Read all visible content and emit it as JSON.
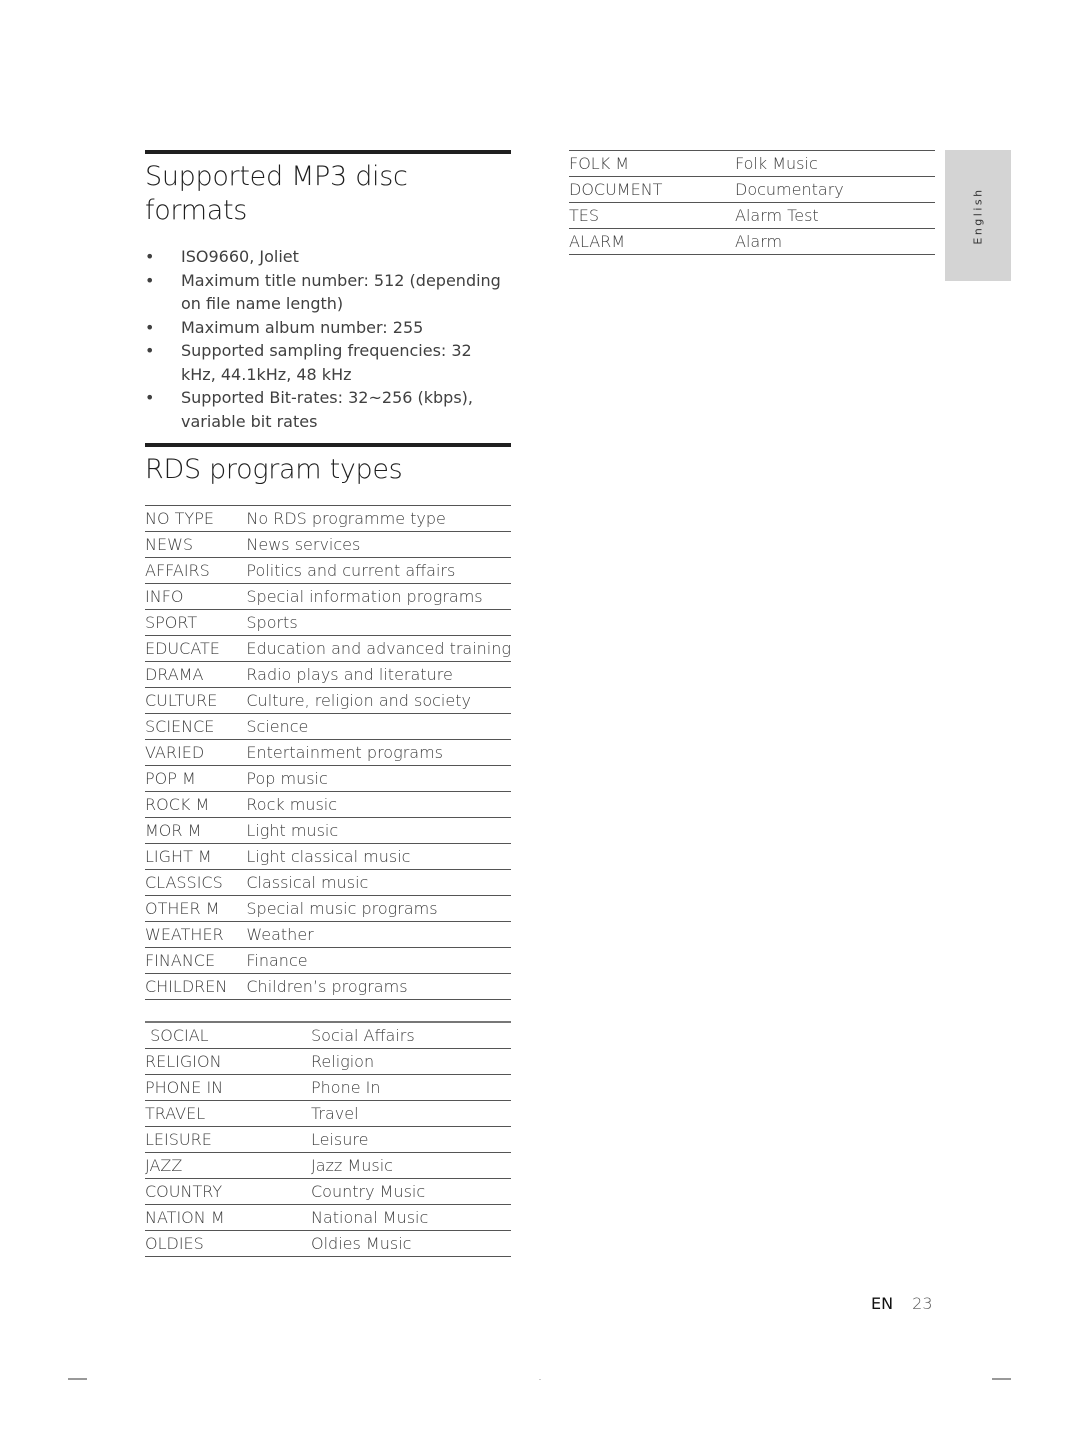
{
  "mp3_section": {
    "title": "Supported MP3 disc formats",
    "bullet_glyph": "•",
    "items": [
      "ISO9660, Joliet",
      "Maximum title number: 512 (depending on file name length)",
      "Maximum album number: 255",
      "Supported sampling frequencies: 32 kHz, 44.1kHz, 48 kHz",
      "Supported Bit-rates: 32~256 (kbps), variable bit rates"
    ]
  },
  "rds_section": {
    "title": "RDS program types",
    "table1": [
      {
        "code": "NO TYPE",
        "desc": "No RDS programme type"
      },
      {
        "code": "NEWS",
        "desc": "News services"
      },
      {
        "code": "AFFAIRS",
        "desc": "Politics and current affairs"
      },
      {
        "code": "INFO",
        "desc": "Special information programs"
      },
      {
        "code": "SPORT",
        "desc": "Sports"
      },
      {
        "code": "EDUCATE",
        "desc": "Education and advanced training"
      },
      {
        "code": "DRAMA",
        "desc": "Radio plays and literature"
      },
      {
        "code": "CULTURE",
        "desc": "Culture, religion and society"
      },
      {
        "code": "SCIENCE",
        "desc": "Science"
      },
      {
        "code": "VARIED",
        "desc": "Entertainment programs"
      },
      {
        "code": "POP M",
        "desc": "Pop music"
      },
      {
        "code": "ROCK M",
        "desc": "Rock music"
      },
      {
        "code": "MOR M",
        "desc": "Light music"
      },
      {
        "code": "LIGHT M",
        "desc": "Light classical music"
      },
      {
        "code": "CLASSICS",
        "desc": "Classical music"
      },
      {
        "code": "OTHER M",
        "desc": "Special music programs"
      },
      {
        "code": "WEATHER",
        "desc": "Weather"
      },
      {
        "code": "FINANCE",
        "desc": "Finance"
      },
      {
        "code": "CHILDREN",
        "desc": "Children’s programs"
      }
    ],
    "table2": [
      {
        "code": " SOCIAL",
        "desc": "Social Affairs"
      },
      {
        "code": "RELIGION",
        "desc": "Religion"
      },
      {
        "code": "PHONE IN",
        "desc": "Phone In"
      },
      {
        "code": "TRAVEL",
        "desc": "Travel"
      },
      {
        "code": "LEISURE",
        "desc": "Leisure"
      },
      {
        "code": "JAZZ",
        "desc": "Jazz Music"
      },
      {
        "code": "COUNTRY",
        "desc": "Country Music"
      },
      {
        "code": "NATION M",
        "desc": "National Music"
      },
      {
        "code": "OLDIES",
        "desc": "Oldies Music"
      }
    ],
    "table3": [
      {
        "code": "FOLK M",
        "desc": "Folk Music"
      },
      {
        "code": "DOCUMENT",
        "desc": "Documentary"
      },
      {
        "code": "TES",
        "desc": "Alarm Test"
      },
      {
        "code": "ALARM",
        "desc": "Alarm"
      }
    ]
  },
  "language_tab": "English",
  "footer": {
    "lang": "EN",
    "page": "23"
  }
}
